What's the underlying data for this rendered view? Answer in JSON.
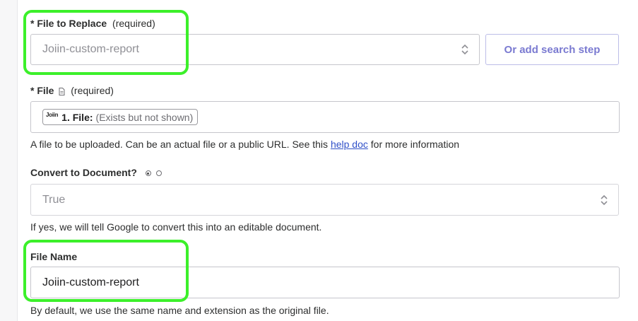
{
  "file_to_replace": {
    "asterisk": "*",
    "label": "File to Replace",
    "required": "(required)",
    "value": "Joiin-custom-report",
    "search_step_button": "Or add search step"
  },
  "file": {
    "asterisk": "*",
    "label": "File",
    "required": "(required)",
    "pill_logo": "Joiin",
    "pill_step": "1. File:",
    "pill_note": "(Exists but not shown)",
    "help_prefix": "A file to be uploaded. Can be an actual file or a public URL. See this ",
    "help_link": "help doc",
    "help_suffix": " for more information",
    "icon": "document-icon"
  },
  "convert": {
    "label": "Convert to Document?",
    "value": "True",
    "help": "If yes, we will tell Google to convert this into an editable document.",
    "radio_icons": [
      "radio-selected-icon",
      "radio-empty-icon"
    ]
  },
  "file_name": {
    "label": "File Name",
    "value": "Joiin-custom-report",
    "help": "By default, we use the same name and extension as the original file."
  },
  "colors": {
    "highlight": "#3cf02a",
    "link": "#3050c8",
    "button_text": "#7a7ad1"
  }
}
